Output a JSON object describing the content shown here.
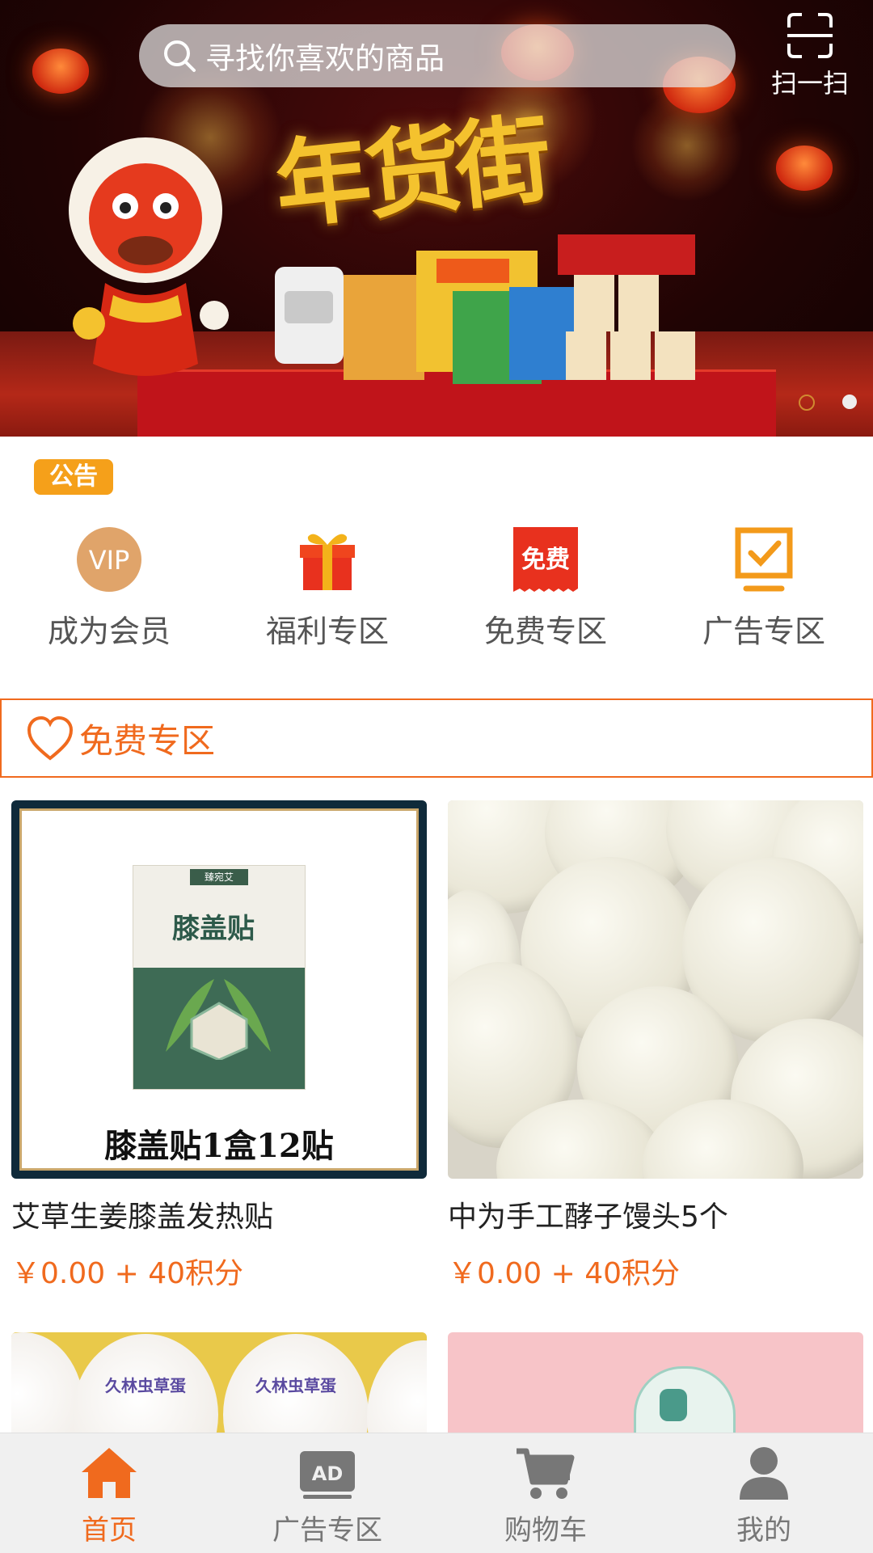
{
  "search": {
    "placeholder": "寻找你喜欢的商品"
  },
  "scan": {
    "label": "扫一扫"
  },
  "banner": {
    "title": "年货街",
    "slide_count": 2,
    "active_slide": 2
  },
  "notice": {
    "badge": "公告"
  },
  "quick_menu": [
    {
      "label": "成为会员",
      "icon": "vip-icon",
      "icon_text": "VIP"
    },
    {
      "label": "福利专区",
      "icon": "gift-icon"
    },
    {
      "label": "免费专区",
      "icon": "free-tag-icon",
      "icon_text": "免费"
    },
    {
      "label": "广告专区",
      "icon": "ad-screen-icon"
    }
  ],
  "section": {
    "title": "免费专区",
    "icon": "heart-outline-icon"
  },
  "products": [
    {
      "name": "艾草生姜膝盖发热贴",
      "price": "￥0.00 + 40积分",
      "image_caption": "膝盖贴1盒12贴",
      "box_title": "膝盖贴",
      "box_brand": "臻宛艾"
    },
    {
      "name": "中为手工酵子馒头5个",
      "price": "￥0.00 + 40积分"
    },
    {
      "egg_stamp": "久林虫草蛋"
    },
    {}
  ],
  "tabbar": [
    {
      "label": "首页",
      "icon": "home-icon",
      "active": true
    },
    {
      "label": "广告专区",
      "icon": "ad-icon",
      "icon_text": "AD",
      "active": false
    },
    {
      "label": "购物车",
      "icon": "cart-icon",
      "active": false
    },
    {
      "label": "我的",
      "icon": "user-icon",
      "active": false
    }
  ],
  "colors": {
    "accent": "#f06a1e",
    "notice": "#f5a01a",
    "tab_inactive": "#777777",
    "vip": "#e0a46a",
    "free_red": "#e8311e",
    "ad_orange": "#f39a1a"
  }
}
